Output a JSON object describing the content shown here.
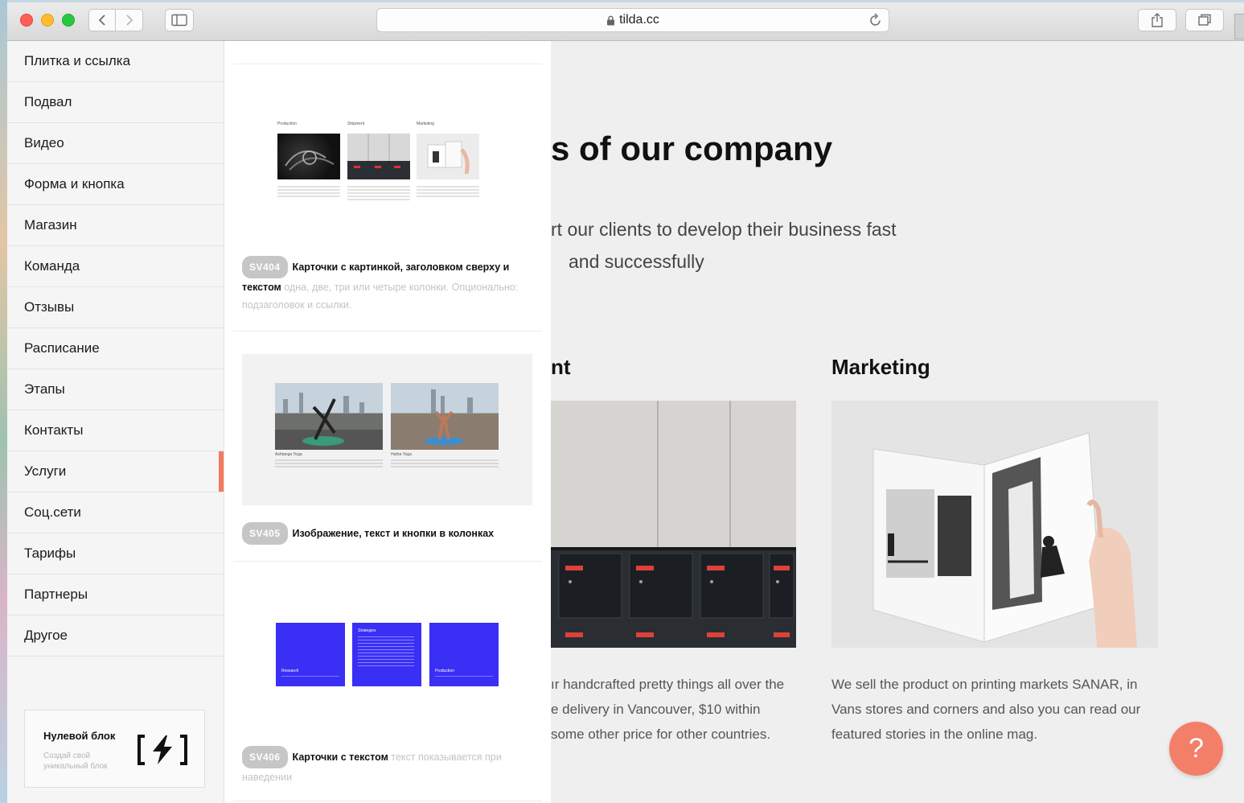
{
  "browser": {
    "url": "tilda.cc"
  },
  "menu": {
    "items": [
      {
        "label": "Плитка и ссылка"
      },
      {
        "label": "Подвал"
      },
      {
        "label": "Видео"
      },
      {
        "label": "Форма и кнопка"
      },
      {
        "label": "Магазин"
      },
      {
        "label": "Команда"
      },
      {
        "label": "Отзывы"
      },
      {
        "label": "Расписание"
      },
      {
        "label": "Этапы"
      },
      {
        "label": "Контакты"
      },
      {
        "label": "Услуги"
      },
      {
        "label": "Соц.сети"
      },
      {
        "label": "Тарифы"
      },
      {
        "label": "Партнеры"
      },
      {
        "label": "Другое"
      }
    ],
    "active_label": "Услуги",
    "zero_block": {
      "title": "Нулевой блок",
      "subtitle": "Создай свой уникальный блок"
    }
  },
  "blocks": [
    {
      "code": "SV404",
      "title": "Карточки с картинкой, заголовком сверху и текстом",
      "desc": "одна, две, три или четыре колонки. Опционально: подзаголовок и ссылки.",
      "preview_labels": [
        "Production",
        "Shipment",
        "Marketing"
      ]
    },
    {
      "code": "SV405",
      "title": "Изображение, текст и кнопки в колонках",
      "desc": "",
      "preview_labels": [
        "Ashtanga Yoga",
        "Hatha Yoga"
      ]
    },
    {
      "code": "SV406",
      "title": "Карточки с текстом",
      "desc": "текст показывается при наведении",
      "preview_labels": [
        "Research",
        "Strategies",
        "Production"
      ]
    }
  ],
  "page": {
    "headline": "s of our company",
    "subline1": "rt our clients to develop their business fast",
    "subline2": "and successfully",
    "col1": {
      "title": "nt",
      "text": [
        "ır handcrafted pretty things all over the",
        "e delivery in Vancouver, $10 within",
        "some other price for other countries."
      ]
    },
    "col2": {
      "title": "Marketing",
      "text": [
        "We sell the product on printing markets SANAR, in",
        "Vans stores and corners and also you can read our",
        "featured stories in the online mag."
      ]
    }
  },
  "help_button": {
    "label": "?"
  },
  "colors": {
    "accent": "#f0795f",
    "help": "#f37f69",
    "blue_card": "#3a2ff5"
  }
}
